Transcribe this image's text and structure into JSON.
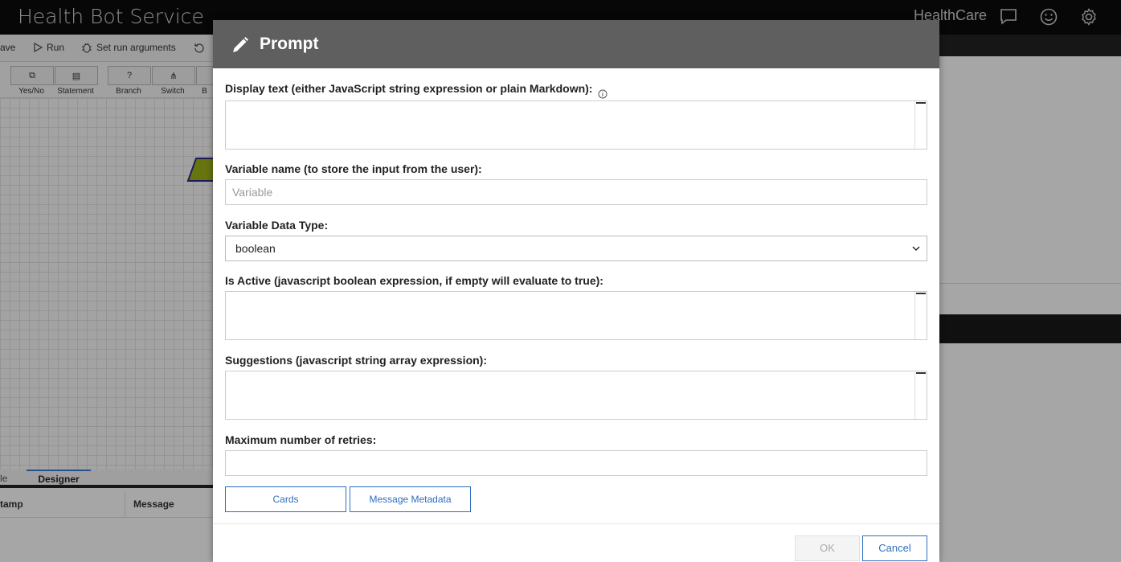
{
  "app": {
    "title": "Health Bot Service",
    "tenant": "HealthCare",
    "icons": [
      "chat-icon",
      "smiley-icon",
      "gear-icon"
    ]
  },
  "toolbar": {
    "save_label": "ave",
    "run_label": "Run",
    "set_run_args_label": "Set run arguments"
  },
  "palette": {
    "items": [
      {
        "label": "Yes/No",
        "icon": "yes-no-icon"
      },
      {
        "label": "Statement",
        "icon": "statement-icon"
      },
      {
        "label": "Branch",
        "icon": "question-icon"
      },
      {
        "label": "Switch",
        "icon": "switch-icon"
      },
      {
        "label": "B"
      }
    ]
  },
  "bottom": {
    "tabs": [
      "le",
      "Designer"
    ],
    "columns": [
      "tamp",
      "Message"
    ]
  },
  "modal": {
    "title": "Prompt",
    "display_text_label": "Display text (either JavaScript string expression or plain Markdown):",
    "variable_name_label": "Variable name (to store the input from the user):",
    "variable_name_placeholder": "Variable",
    "data_type_label": "Variable Data Type:",
    "data_type_value": "boolean",
    "is_active_label": "Is Active (javascript boolean expression, if empty will evaluate to true):",
    "suggestions_label": "Suggestions (javascript string array expression):",
    "max_retries_label": "Maximum number of retries:",
    "cards_button": "Cards",
    "metadata_button": "Message Metadata",
    "ok_button": "OK",
    "cancel_button": "Cancel"
  },
  "colors": {
    "header": "#5f5f5f",
    "accent": "#2f6fbf",
    "topbar": "#0b0b0b"
  }
}
